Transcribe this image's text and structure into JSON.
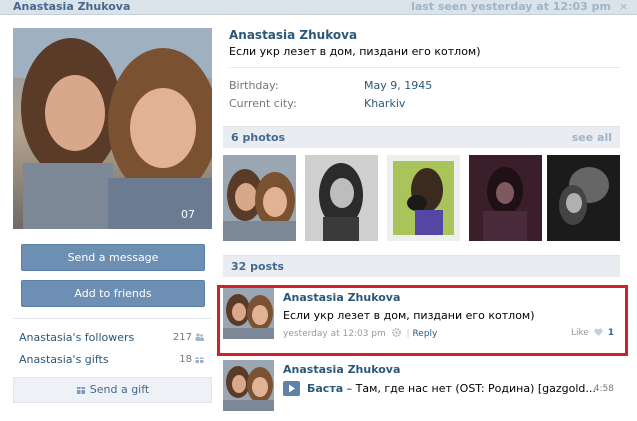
{
  "header": {
    "name": "Anastasia Zhukova",
    "last_seen": "last seen yesterday at 12:03 pm",
    "close": "×"
  },
  "sidebar": {
    "send_message": "Send a message",
    "add_friends": "Add to friends",
    "followers_label": "Anastasia's followers",
    "followers_count": "217",
    "gifts_label": "Anastasia's gifts",
    "gifts_count": "18",
    "send_gift": "Send a gift"
  },
  "profile": {
    "name": "Anastasia Zhukova",
    "status": "Если укр лезет в дом, пиздани его котлом)",
    "birthday_label": "Birthday:",
    "birthday_value": "May 9, 1945",
    "city_label": "Current city:",
    "city_value": "Kharkiv"
  },
  "photos_section": {
    "title": "6 photos",
    "see_all": "see all"
  },
  "posts_section": {
    "title": "32 posts"
  },
  "posts": [
    {
      "author": "Anastasia Zhukova",
      "text": "Если укр лезет в дом, пиздани его котлом)",
      "time": "yesterday at 12:03 pm",
      "reply": "Reply",
      "like_label": "Like",
      "like_count": "1"
    },
    {
      "author": "Anastasia Zhukova",
      "audio_artist": "Баста",
      "audio_title": "– Там, где нас нет (OST: Родина) [gazgold...",
      "audio_duration": "4:58"
    }
  ],
  "colors": {
    "link": "#2b587a",
    "button": "#6d8fb3",
    "header_bg": "#dae2ea",
    "highlight": "#d4202b"
  }
}
